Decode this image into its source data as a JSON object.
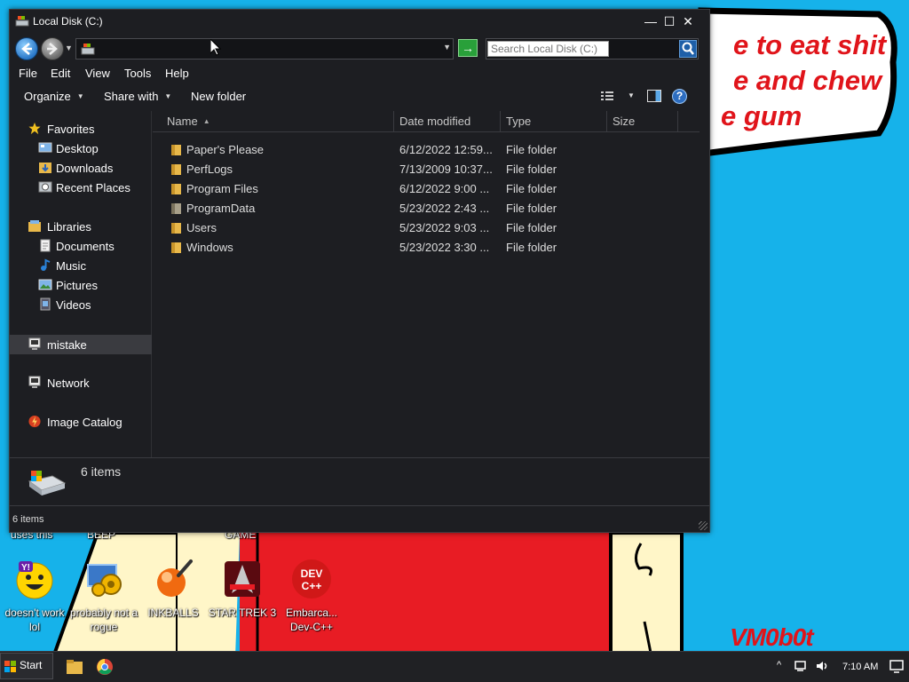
{
  "wallpaper": {
    "line1": "e to eat shit",
    "line2": "e and chew",
    "line3": "e gum",
    "signature": "VM0b0t"
  },
  "desktop": {
    "top_row_captions": [
      "uses this",
      "BEEP",
      "GAME"
    ],
    "icons": [
      {
        "label": "doesn't work lol",
        "icon": "yahoo-messenger-icon"
      },
      {
        "label": "probably not a rogue",
        "icon": "gear-computer-icon"
      },
      {
        "label": "INKBALLS",
        "icon": "inkball-icon"
      },
      {
        "label": "STAR TREK 3",
        "icon": "star-trek-icon"
      },
      {
        "label": "Embarca... Dev-C++",
        "icon": "dev-cpp-icon"
      }
    ]
  },
  "window": {
    "title": "Local Disk (C:)",
    "controls": {
      "minimize": "—",
      "maximize": "☐",
      "close": "✕"
    }
  },
  "address": {
    "value": "",
    "go_label": "→"
  },
  "search": {
    "placeholder": "Search Local Disk (C:)"
  },
  "menu": [
    "File",
    "Edit",
    "View",
    "Tools",
    "Help"
  ],
  "commands": {
    "organize": "Organize",
    "share": "Share with",
    "new_folder": "New folder",
    "help": "?"
  },
  "nav": {
    "favorites": {
      "label": "Favorites",
      "items": [
        "Desktop",
        "Downloads",
        "Recent Places"
      ]
    },
    "libraries": {
      "label": "Libraries",
      "items": [
        "Documents",
        "Music",
        "Pictures",
        "Videos"
      ]
    },
    "computer": "mistake",
    "network": "Network",
    "catalog": "Image Catalog"
  },
  "columns": {
    "name": "Name",
    "date": "Date modified",
    "type": "Type",
    "size": "Size"
  },
  "files": [
    {
      "name": "Paper's Please",
      "date": "6/12/2022 12:59...",
      "type": "File folder"
    },
    {
      "name": "PerfLogs",
      "date": "7/13/2009 10:37...",
      "type": "File folder"
    },
    {
      "name": "Program Files",
      "date": "6/12/2022 9:00 ...",
      "type": "File folder"
    },
    {
      "name": "ProgramData",
      "date": "5/23/2022 2:43 ...",
      "type": "File folder"
    },
    {
      "name": "Users",
      "date": "5/23/2022 9:03 ...",
      "type": "File folder"
    },
    {
      "name": "Windows",
      "date": "5/23/2022 3:30 ...",
      "type": "File folder"
    }
  ],
  "details": {
    "count": "6 items"
  },
  "status": {
    "count": "6 items"
  },
  "taskbar": {
    "start": "Start",
    "clock": "7:10 AM",
    "tray_caret": "^"
  },
  "colors": {
    "desktop_bg": "#16b2ea",
    "window_bg": "#1d1e22",
    "wallpaper_red": "#e0141a",
    "folder_yellow": "#e8b84a"
  }
}
